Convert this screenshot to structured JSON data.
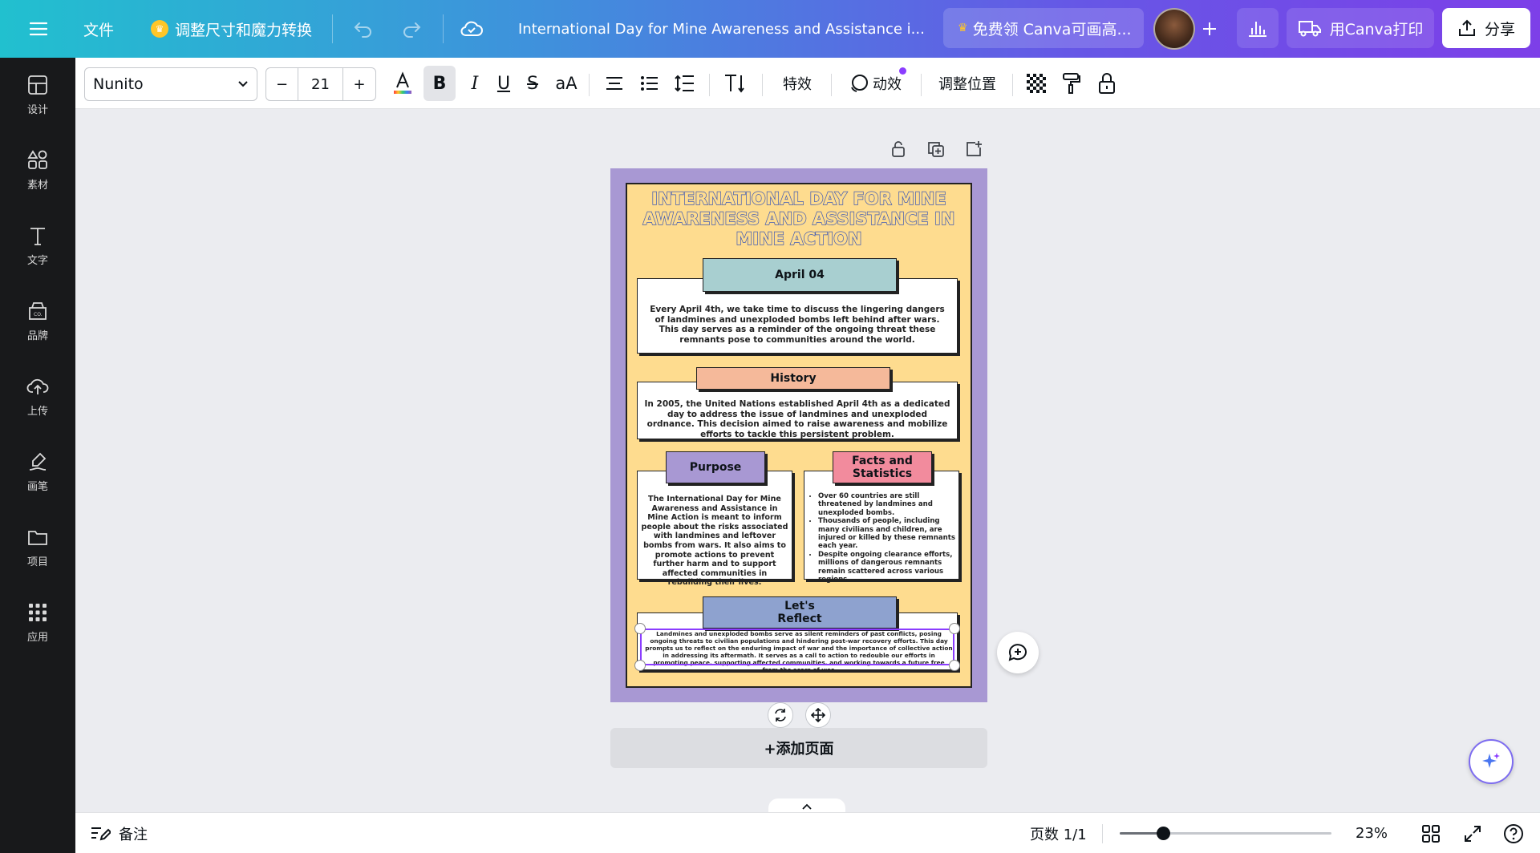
{
  "topbar": {
    "menu_icon": "hamburger-icon",
    "file_label": "文件",
    "resize_label": "调整尺寸和魔力转换",
    "doc_title": "International Day for Mine Awareness and Assistance i...",
    "promo_label": "免费领 Canva可画高...",
    "print_label": "用Canva打印",
    "share_label": "分享"
  },
  "sidebar": {
    "items": [
      {
        "label": "设计",
        "icon": "layout-icon"
      },
      {
        "label": "素材",
        "icon": "shapes-icon"
      },
      {
        "label": "文字",
        "icon": "text-icon"
      },
      {
        "label": "品牌",
        "icon": "brand-icon"
      },
      {
        "label": "上传",
        "icon": "upload-icon"
      },
      {
        "label": "画笔",
        "icon": "draw-icon"
      },
      {
        "label": "项目",
        "icon": "folder-icon"
      },
      {
        "label": "应用",
        "icon": "apps-icon"
      }
    ]
  },
  "toolbar": {
    "font_name": "Nunito",
    "font_size": "21",
    "minus": "−",
    "plus": "+",
    "effects_label": "特效",
    "animate_label": "动效",
    "position_label": "调整位置"
  },
  "design": {
    "title": "INTERNATIONAL DAY FOR MINE AWARENESS AND ASSISTANCE IN MINE ACTION",
    "date_tag": "April 04",
    "date_text": "Every April 4th, we take time to discuss the lingering dangers of landmines and unexploded bombs left behind after wars. This day serves as a reminder of the ongoing threat these remnants pose to communities around the world.",
    "history_tag": "History",
    "history_text": "In 2005, the United Nations established April 4th as a dedicated day to address the issue of landmines and unexploded ordnance. This decision aimed to raise awareness and mobilize efforts to tackle this persistent problem.",
    "purpose_tag": "Purpose",
    "purpose_text": "The International Day for Mine Awareness and Assistance in Mine Action is meant to inform people about the risks associated with landmines and leftover bombs from wars. It also aims to promote actions to prevent further harm and to support affected communities in rebuilding their lives.",
    "facts_tag_line1": "Facts and",
    "facts_tag_line2": "Statistics",
    "facts": [
      "Over 60 countries are still threatened by landmines and unexploded bombs.",
      "Thousands of people, including many civilians and children, are injured or killed by these remnants each year.",
      "Despite ongoing clearance efforts, millions of dangerous remnants remain scattered across various regions."
    ],
    "reflect_tag_line1": "Let's",
    "reflect_tag_line2": "Reflect",
    "reflect_text": "Landmines and unexploded bombs serve as silent reminders of past conflicts, posing ongoing threats to civilian populations and hindering post-war recovery efforts. This day prompts us to reflect on the enduring impact of war and the importance of collective action in addressing its aftermath. It serves as a call to action to redouble our efforts in promoting peace, supporting affected communities, and working towards a future free from the scars of war."
  },
  "canvas": {
    "add_page_label": "+添加页面"
  },
  "bottombar": {
    "notes_label": "备注",
    "page_count": "页数 1/1",
    "zoom": "23%",
    "zoom_level": 0.23
  },
  "colors": {
    "design_bg": "#a898d3",
    "inner_bg": "#fedc8f",
    "title_outline": "#3c58b6",
    "tag_teal": "#a8cfd0",
    "tag_peach": "#f5b99a",
    "tag_purple": "#a898d3",
    "tag_pink": "#f28b9d",
    "tag_blue": "#8ea2cf",
    "accent_purple": "#8b3dff"
  }
}
